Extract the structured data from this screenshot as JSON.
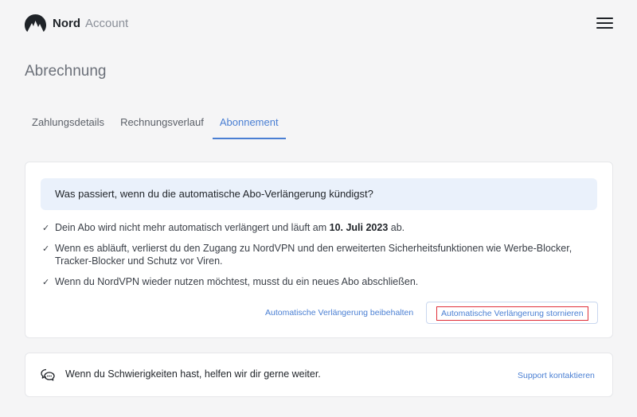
{
  "header": {
    "brand": "Nord",
    "brand_sub": "Account",
    "logo_icon": "nord-mountain-logo",
    "menu_icon": "hamburger-menu-icon"
  },
  "page": {
    "title": "Abrechnung"
  },
  "tabs": [
    {
      "label": "Zahlungsdetails",
      "active": false
    },
    {
      "label": "Rechnungsverlauf",
      "active": false
    },
    {
      "label": "Abonnement",
      "active": true
    }
  ],
  "cancel_card": {
    "question": "Was passiert, wenn du die automatische Abo-Verlängerung kündigst?",
    "items": [
      {
        "pre": "Dein Abo wird nicht mehr automatisch verlängert und läuft am ",
        "bold": "10. Juli 2023",
        "post": " ab."
      },
      {
        "text": "Wenn es abläuft, verlierst du den Zugang zu NordVPN und den erweiterten Sicherheitsfunktionen wie Werbe-Blocker, Tracker-Blocker und Schutz vor Viren."
      },
      {
        "text": "Wenn du NordVPN wieder nutzen möchtest, musst du ein neues Abo abschließen."
      }
    ],
    "keep_label": "Automatische Verlängerung beibehalten",
    "cancel_label": "Automatische Verlängerung stornieren"
  },
  "support_card": {
    "text": "Wenn du Schwierigkeiten hast, helfen wir dir gerne weiter.",
    "link": "Support kontaktieren",
    "icon": "chat-bubbles-icon"
  },
  "colors": {
    "accent": "#4a7fd3",
    "info_bg": "#eaf1fb",
    "highlight_border": "#e0303a"
  }
}
